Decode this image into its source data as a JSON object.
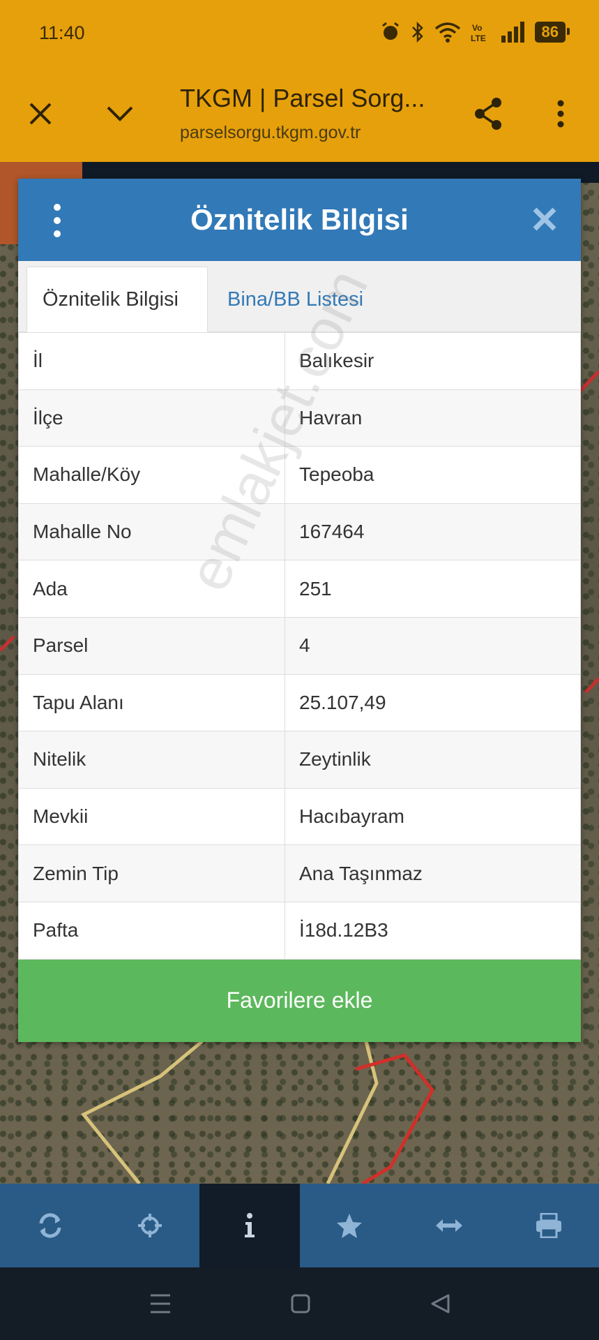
{
  "status_bar": {
    "time": "11:40",
    "battery": "86"
  },
  "browser": {
    "title": "TKGM | Parsel Sorg...",
    "url": "parselsorgu.tkgm.gov.tr"
  },
  "popup": {
    "title": "Öznitelik Bilgisi",
    "tabs": [
      {
        "label": "Öznitelik Bilgisi",
        "active": true
      },
      {
        "label": "Bina/BB Listesi",
        "active": false
      }
    ],
    "rows": [
      {
        "key": "İl",
        "value": "Balıkesir"
      },
      {
        "key": "İlçe",
        "value": "Havran"
      },
      {
        "key": "Mahalle/Köy",
        "value": "Tepeoba"
      },
      {
        "key": "Mahalle No",
        "value": "167464"
      },
      {
        "key": "Ada",
        "value": "251"
      },
      {
        "key": "Parsel",
        "value": "4"
      },
      {
        "key": "Tapu Alanı",
        "value": "25.107,49"
      },
      {
        "key": "Nitelik",
        "value": "Zeytinlik"
      },
      {
        "key": "Mevkii",
        "value": "Hacıbayram"
      },
      {
        "key": "Zemin Tip",
        "value": "Ana Taşınmaz"
      },
      {
        "key": "Pafta",
        "value": "İ18d.12B3"
      }
    ],
    "favorite_button": "Favorilere ekle"
  },
  "watermark": "emlakjet.com",
  "toolbar": {
    "items": [
      {
        "icon": "refresh-icon"
      },
      {
        "icon": "crosshair-icon"
      },
      {
        "icon": "info-icon",
        "active": true
      },
      {
        "icon": "star-icon"
      },
      {
        "icon": "measure-icon"
      },
      {
        "icon": "print-icon"
      }
    ]
  },
  "colors": {
    "browser_bar": "#e6a00b",
    "popup_header": "#3279b7",
    "favorite_button": "#5cb85c",
    "toolbar": "#2a5a86"
  }
}
